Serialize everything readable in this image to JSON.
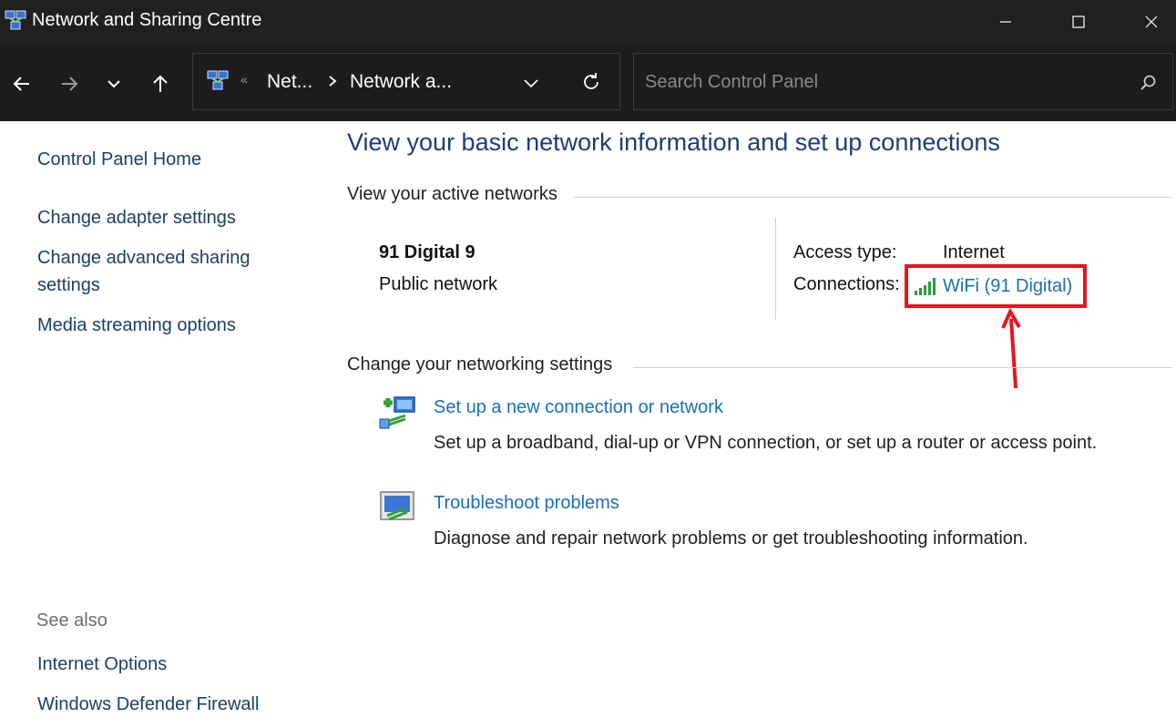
{
  "window": {
    "title": "Network and Sharing Centre"
  },
  "address_bar": {
    "overflow_marker": "«",
    "crumbs": [
      "Net...",
      "Network a..."
    ]
  },
  "search": {
    "placeholder": "Search Control Panel"
  },
  "sidebar": {
    "links": [
      "Control Panel Home",
      "Change adapter settings",
      "Change advanced sharing settings",
      "Media streaming options"
    ],
    "see_also_label": "See also",
    "see_also_links": [
      "Internet Options",
      "Windows Defender Firewall"
    ]
  },
  "main": {
    "heading": "View your basic network information and set up connections",
    "active_networks": {
      "section_title": "View your active networks",
      "network_name": "91 Digital 9",
      "network_category": "Public network",
      "access_type_label": "Access type:",
      "access_type_value": "Internet",
      "connections_label": "Connections:",
      "connection_link": "WiFi (91 Digital)"
    },
    "networking_settings": {
      "section_title": "Change your networking settings",
      "tasks": [
        {
          "link": "Set up a new connection or network",
          "description": "Set up a broadband, dial-up or VPN connection, or set up a router or access point."
        },
        {
          "link": "Troubleshoot problems",
          "description": "Diagnose and repair network problems or get troubleshooting information."
        }
      ]
    }
  },
  "colors": {
    "link": "#1a6fb5",
    "heading": "#1e3c78",
    "highlight": "#e8141a",
    "titlebar": "#202020"
  }
}
